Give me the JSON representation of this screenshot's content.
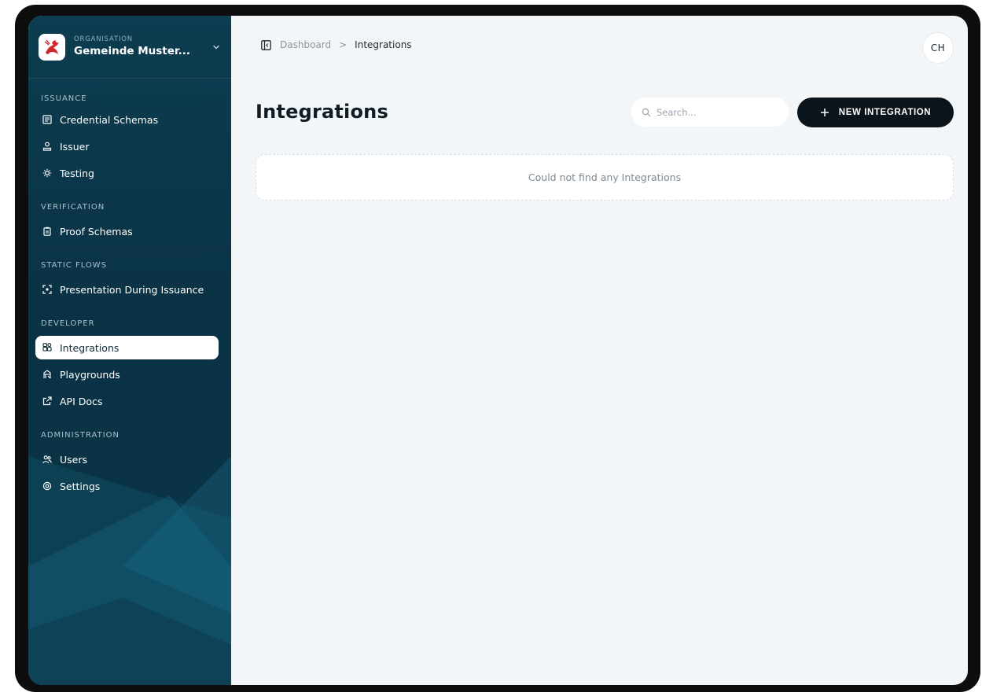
{
  "organisation": {
    "kicker": "ORGANISATION",
    "name": "Gemeinde Muster..."
  },
  "sidebar": {
    "sections": [
      {
        "title": "ISSUANCE",
        "items": [
          {
            "label": "Credential Schemas",
            "icon": "credential-schemas-icon"
          },
          {
            "label": "Issuer",
            "icon": "issuer-icon"
          },
          {
            "label": "Testing",
            "icon": "testing-icon"
          }
        ]
      },
      {
        "title": "VERIFICATION",
        "items": [
          {
            "label": "Proof Schemas",
            "icon": "clipboard-icon"
          }
        ]
      },
      {
        "title": "STATIC FLOWS",
        "items": [
          {
            "label": "Presentation During Issuance",
            "icon": "scan-icon"
          }
        ]
      },
      {
        "title": "DEVELOPER",
        "items": [
          {
            "label": "Integrations",
            "icon": "integrations-icon",
            "active": true
          },
          {
            "label": "Playgrounds",
            "icon": "playgrounds-icon"
          },
          {
            "label": "API Docs",
            "icon": "external-link-icon"
          }
        ]
      },
      {
        "title": "ADMINISTRATION",
        "items": [
          {
            "label": "Users",
            "icon": "users-icon"
          },
          {
            "label": "Settings",
            "icon": "settings-icon"
          }
        ]
      }
    ]
  },
  "breadcrumb": {
    "root": "Dashboard",
    "separator": ">",
    "current": "Integrations"
  },
  "user": {
    "initials": "CH"
  },
  "page": {
    "title": "Integrations",
    "search_placeholder": "Search...",
    "new_button_label": "NEW INTEGRATION",
    "empty_message": "Could not find any Integrations"
  },
  "colors": {
    "sidebar": "#0d3d50",
    "background": "#f3f6f9",
    "primary_button": "#0b141b"
  }
}
